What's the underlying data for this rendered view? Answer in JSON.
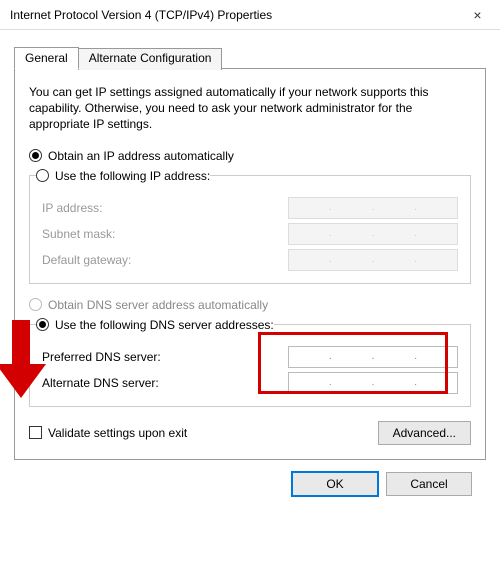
{
  "window": {
    "title": "Internet Protocol Version 4 (TCP/IPv4) Properties",
    "close_icon": "×"
  },
  "tabs": {
    "general": "General",
    "alternate": "Alternate Configuration"
  },
  "intro": "You can get IP settings assigned automatically if your network supports this capability. Otherwise, you need to ask your network administrator for the appropriate IP settings.",
  "ip": {
    "auto": "Obtain an IP address automatically",
    "manual": "Use the following IP address:",
    "address_label": "IP address:",
    "subnet_label": "Subnet mask:",
    "gateway_label": "Default gateway:"
  },
  "dns": {
    "auto": "Obtain DNS server address automatically",
    "manual": "Use the following DNS server addresses:",
    "preferred_label": "Preferred DNS server:",
    "alternate_label": "Alternate DNS server:"
  },
  "validate": "Validate settings upon exit",
  "buttons": {
    "advanced": "Advanced...",
    "ok": "OK",
    "cancel": "Cancel"
  },
  "colors": {
    "annotation": "#d20000"
  }
}
